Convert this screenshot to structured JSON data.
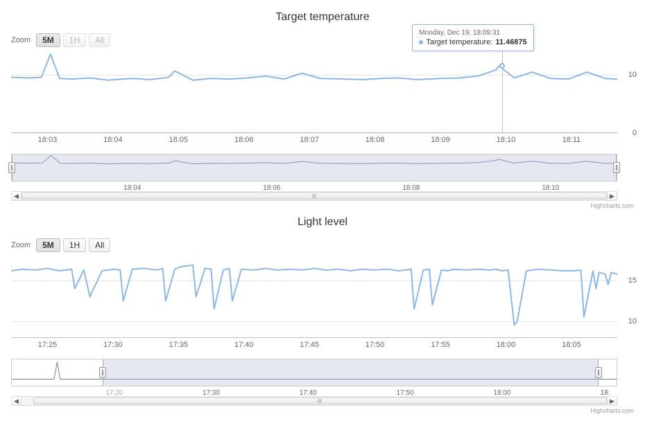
{
  "charts": [
    {
      "title": "Target temperature",
      "zoom_label": "Zoom",
      "zoom_buttons": [
        {
          "label": "5M",
          "state": "active"
        },
        {
          "label": "1H",
          "state": "disabled"
        },
        {
          "label": "All",
          "state": "disabled"
        }
      ],
      "y_ticks": [
        0,
        10
      ],
      "y_range": [
        0,
        14
      ],
      "x_ticks": [
        "18:03",
        "18:04",
        "18:05",
        "18:06",
        "18:07",
        "18:08",
        "18:09",
        "18:10",
        "18:11"
      ],
      "tooltip": {
        "header": "Monday, Dec 19, 18:09:31",
        "series_label": "Target temperature:",
        "value": "11.46875",
        "x_frac": 0.805
      },
      "nav_ticks": [
        {
          "label": "18:04",
          "frac": 0.2,
          "inrange": true
        },
        {
          "label": "18:06",
          "frac": 0.43,
          "inrange": true
        },
        {
          "label": "18:08",
          "frac": 0.66,
          "inrange": true
        },
        {
          "label": "18:10",
          "frac": 0.89,
          "inrange": true
        }
      ],
      "nav_range": [
        0.0,
        1.0
      ],
      "scrollbar_thumb": [
        0.0,
        1.0
      ],
      "credit": "Highcharts.com"
    },
    {
      "title": "Light level",
      "zoom_label": "Zoom",
      "zoom_buttons": [
        {
          "label": "5M",
          "state": "active"
        },
        {
          "label": "1H",
          "state": "normal"
        },
        {
          "label": "All",
          "state": "normal"
        }
      ],
      "y_ticks": [
        10,
        15
      ],
      "y_range": [
        8,
        18
      ],
      "x_ticks": [
        "17:25",
        "17:30",
        "17:35",
        "17:40",
        "17:45",
        "17:50",
        "17:55",
        "18:00",
        "18:05"
      ],
      "tooltip": null,
      "nav_ticks": [
        {
          "label": "17:20",
          "frac": 0.17,
          "inrange": false
        },
        {
          "label": "17:30",
          "frac": 0.33,
          "inrange": true
        },
        {
          "label": "17:40",
          "frac": 0.49,
          "inrange": true
        },
        {
          "label": "17:50",
          "frac": 0.65,
          "inrange": true
        },
        {
          "label": "18:00",
          "frac": 0.81,
          "inrange": true
        },
        {
          "label": "18:",
          "frac": 0.98,
          "inrange": true
        }
      ],
      "nav_range": [
        0.15,
        0.97
      ],
      "scrollbar_thumb": [
        0.02,
        1.0
      ],
      "credit": "Highcharts.com"
    }
  ],
  "chart_data": [
    {
      "type": "line",
      "title": "Target temperature",
      "xlabel": "",
      "ylabel": "",
      "ylim": [
        0,
        14
      ],
      "x_axis_labels": [
        "18:03",
        "18:04",
        "18:05",
        "18:06",
        "18:07",
        "18:08",
        "18:09",
        "18:10",
        "18:11"
      ],
      "series": [
        {
          "name": "Target temperature",
          "x_frac": [
            0.0,
            0.03,
            0.05,
            0.065,
            0.08,
            0.1,
            0.13,
            0.16,
            0.2,
            0.23,
            0.26,
            0.27,
            0.3,
            0.33,
            0.36,
            0.39,
            0.42,
            0.45,
            0.48,
            0.51,
            0.55,
            0.58,
            0.61,
            0.64,
            0.67,
            0.71,
            0.74,
            0.77,
            0.8,
            0.805,
            0.83,
            0.86,
            0.89,
            0.92,
            0.95,
            0.98,
            1.0
          ],
          "y": [
            9.5,
            9.4,
            9.5,
            13.5,
            9.3,
            9.2,
            9.4,
            9.0,
            9.3,
            9.1,
            9.5,
            10.6,
            9.0,
            9.3,
            9.2,
            9.4,
            9.7,
            9.2,
            10.2,
            9.3,
            9.2,
            9.1,
            9.3,
            9.4,
            9.1,
            9.3,
            9.4,
            9.7,
            10.8,
            11.47,
            9.4,
            10.4,
            9.3,
            9.2,
            10.4,
            9.3,
            9.2
          ]
        }
      ],
      "tooltip_sample": {
        "datetime": "Monday, Dec 19, 18:09:31",
        "series": "Target temperature",
        "value": 11.46875
      }
    },
    {
      "type": "line",
      "title": "Light level",
      "xlabel": "",
      "ylabel": "",
      "ylim": [
        8,
        18
      ],
      "x_axis_labels": [
        "17:25",
        "17:30",
        "17:35",
        "17:40",
        "17:45",
        "17:50",
        "17:55",
        "18:00",
        "18:05"
      ],
      "series": [
        {
          "name": "Light level",
          "x_frac": [
            0.0,
            0.02,
            0.04,
            0.06,
            0.08,
            0.1,
            0.105,
            0.12,
            0.13,
            0.15,
            0.17,
            0.18,
            0.185,
            0.2,
            0.22,
            0.24,
            0.25,
            0.255,
            0.27,
            0.28,
            0.3,
            0.305,
            0.32,
            0.33,
            0.335,
            0.35,
            0.36,
            0.365,
            0.38,
            0.4,
            0.42,
            0.44,
            0.46,
            0.48,
            0.5,
            0.52,
            0.54,
            0.56,
            0.58,
            0.6,
            0.62,
            0.64,
            0.66,
            0.665,
            0.68,
            0.69,
            0.695,
            0.71,
            0.72,
            0.73,
            0.75,
            0.77,
            0.79,
            0.8,
            0.81,
            0.82,
            0.83,
            0.835,
            0.85,
            0.87,
            0.89,
            0.91,
            0.93,
            0.94,
            0.945,
            0.96,
            0.965,
            0.97,
            0.98,
            0.985,
            0.99,
            1.0
          ],
          "y": [
            16.2,
            16.4,
            16.3,
            16.5,
            16.2,
            16.4,
            14.0,
            16.3,
            13.0,
            16.2,
            16.4,
            16.3,
            12.5,
            16.4,
            16.5,
            16.3,
            16.5,
            12.5,
            16.4,
            16.7,
            16.9,
            13.0,
            16.5,
            16.4,
            11.5,
            16.3,
            16.5,
            12.5,
            16.4,
            16.3,
            16.5,
            16.3,
            16.4,
            16.3,
            16.5,
            16.3,
            16.4,
            16.2,
            16.4,
            16.3,
            16.4,
            16.2,
            16.4,
            11.5,
            16.3,
            16.4,
            12.0,
            16.3,
            16.2,
            16.4,
            16.3,
            16.4,
            16.3,
            16.4,
            16.2,
            16.3,
            9.5,
            10.0,
            16.2,
            16.4,
            16.3,
            16.2,
            16.2,
            16.3,
            10.5,
            16.2,
            14.0,
            16.0,
            15.8,
            14.5,
            16.0,
            15.8
          ]
        }
      ]
    }
  ]
}
